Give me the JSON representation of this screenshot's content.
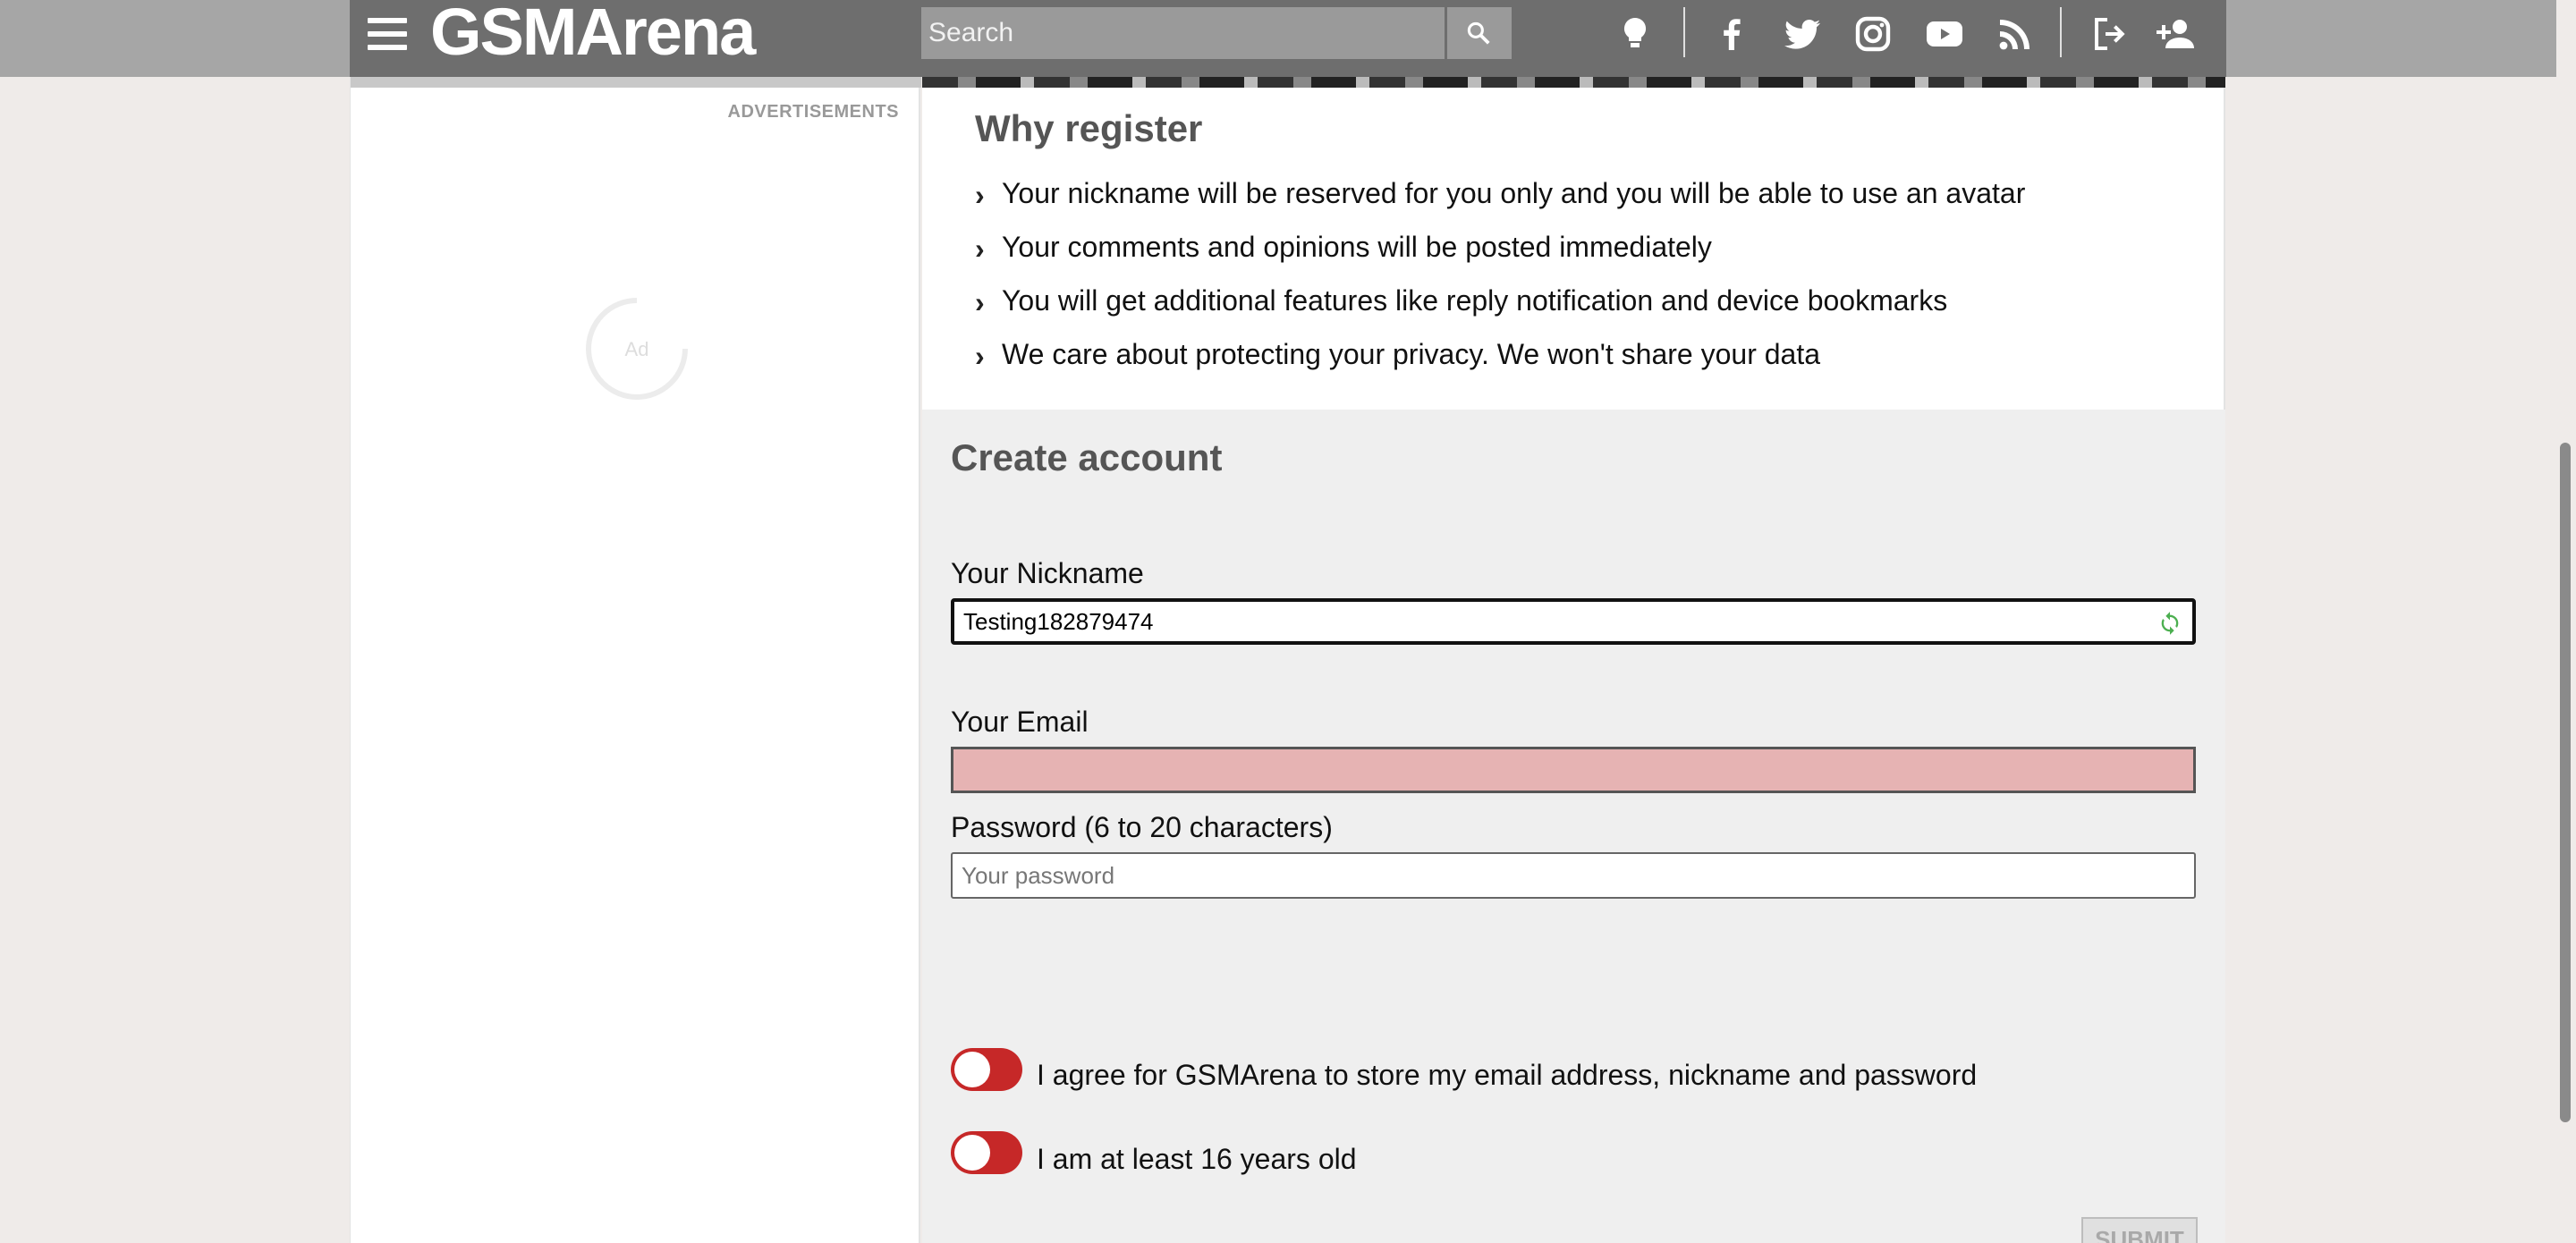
{
  "header": {
    "logo": "GSMArena",
    "search": {
      "placeholder": "Search"
    },
    "icons": [
      "menu-icon",
      "search-icon",
      "lightbulb-icon",
      "facebook-icon",
      "twitter-icon",
      "instagram-icon",
      "youtube-icon",
      "rss-icon",
      "login-icon",
      "add-user-icon"
    ]
  },
  "sidebar": {
    "ads_label": "ADVERTISEMENTS",
    "ad_placeholder": "Ad"
  },
  "why": {
    "title": "Why register",
    "items": [
      "Your nickname will be reserved for you only and you will be able to use an avatar",
      "Your comments and opinions will be posted immediately",
      "You will get additional features like reply notification and device bookmarks",
      "We care about protecting your privacy. We won't share your data"
    ]
  },
  "form": {
    "title": "Create account",
    "nickname_label": "Your Nickname",
    "nickname_value": "Testing182879474",
    "email_label": "Your Email",
    "email_value": "",
    "password_label": "Password (6 to 20 characters)",
    "password_placeholder": "Your password",
    "agree_label": "I agree for GSMArena to store my email address, nickname and password",
    "age_label": "I am at least 16 years old",
    "submit_label": "SUBMIT"
  },
  "colors": {
    "header_bg": "#6e6e6e",
    "error_field": "#e6b3b3",
    "toggle_off": "#c62828",
    "refresh_icon": "#4caf50"
  }
}
